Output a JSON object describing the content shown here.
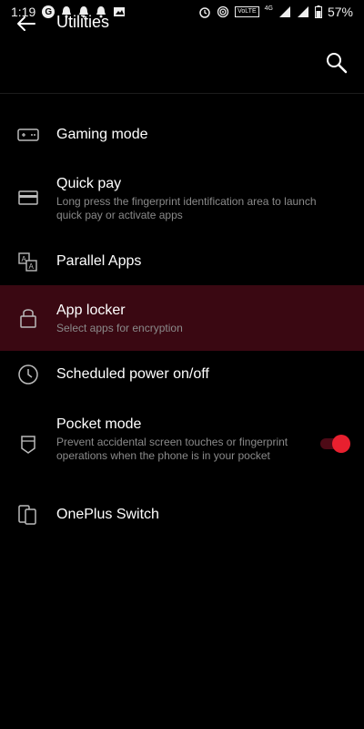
{
  "status_bar": {
    "time": "1:19",
    "g_letter": "G",
    "volte": "VoLTE",
    "network": "4G",
    "battery": "57%"
  },
  "app_bar": {
    "title": "Utilities"
  },
  "items": [
    {
      "label": "Gaming mode",
      "icon": "gamepad-icon"
    },
    {
      "label": "Quick pay",
      "subtitle": "Long press the fingerprint identification area to launch quick pay or activate apps",
      "icon": "card-icon"
    },
    {
      "label": "Parallel Apps",
      "icon": "parallel-apps-icon"
    },
    {
      "label": "App locker",
      "subtitle": "Select apps for encryption",
      "icon": "lock-icon"
    },
    {
      "label": "Scheduled power on/off",
      "icon": "clock-icon"
    },
    {
      "label": "Pocket mode",
      "subtitle": "Prevent accidental screen touches or fingerprint operations when the phone is in your pocket",
      "icon": "pocket-icon",
      "toggle_on": true
    },
    {
      "label": "OnePlus Switch",
      "icon": "phone-switch-icon"
    }
  ],
  "colors": {
    "background": "#000000",
    "highlight": "#3a0812",
    "accent": "#e8202f",
    "subtitle": "#8a8a8a"
  }
}
